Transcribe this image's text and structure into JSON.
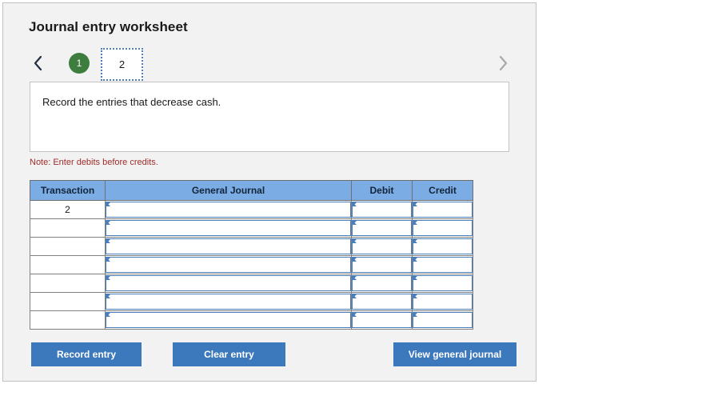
{
  "panel": {
    "title": "Journal entry worksheet"
  },
  "nav": {
    "prev_icon": "chevron-left-icon",
    "next_icon": "chevron-right-icon",
    "tabs": [
      {
        "label": "1",
        "state": "completed"
      },
      {
        "label": "2",
        "state": "selected"
      }
    ]
  },
  "instruction": {
    "text": "Record the entries that decrease cash."
  },
  "note": {
    "text": "Note: Enter debits before credits."
  },
  "table": {
    "headers": [
      "Transaction",
      "General Journal",
      "Debit",
      "Credit"
    ],
    "rows": [
      {
        "transaction": "2",
        "general_journal": "",
        "debit": "",
        "credit": ""
      },
      {
        "transaction": "",
        "general_journal": "",
        "debit": "",
        "credit": ""
      },
      {
        "transaction": "",
        "general_journal": "",
        "debit": "",
        "credit": ""
      },
      {
        "transaction": "",
        "general_journal": "",
        "debit": "",
        "credit": ""
      },
      {
        "transaction": "",
        "general_journal": "",
        "debit": "",
        "credit": ""
      },
      {
        "transaction": "",
        "general_journal": "",
        "debit": "",
        "credit": ""
      },
      {
        "transaction": "",
        "general_journal": "",
        "debit": "",
        "credit": ""
      }
    ]
  },
  "buttons": {
    "record": "Record entry",
    "clear": "Clear entry",
    "view": "View general journal"
  },
  "colors": {
    "panel_background": "#f2f2f2",
    "header_blue": "#7cace4",
    "button_blue": "#3c78bc",
    "tab_green": "#3d7d3d",
    "note_red": "#9e2b2b",
    "field_border_blue": "#4a7ebb"
  }
}
